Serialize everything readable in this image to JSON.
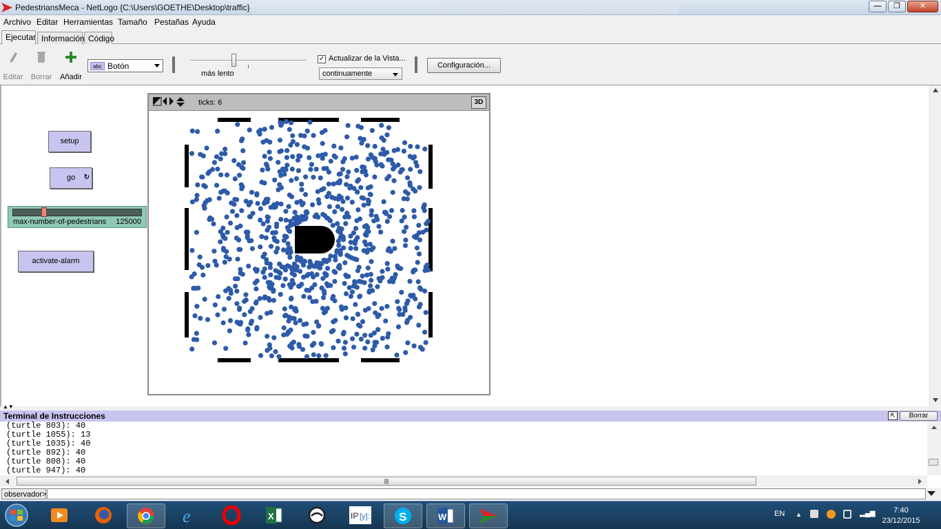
{
  "window": {
    "title": "PedestriansMeca - NetLogo {C:\\Users\\GOETHE\\Desktop\\traffic}",
    "minimize_label": "—",
    "maximize_label": "❐",
    "close_label": "✕"
  },
  "menu": [
    "Archivo",
    "Editar",
    "Herramientas",
    "Tamaño",
    "Pestañas",
    "Ayuda"
  ],
  "tabs": [
    "Ejecutar",
    "Información",
    "Código"
  ],
  "toolbar": {
    "edit_label": "Editar",
    "delete_label": "Borrar",
    "add_label": "Añadir",
    "widget_type": "Botón",
    "widget_type_icon": "abc",
    "speed_label": "más lento",
    "update_view_label": "Actualizar de la Vista...",
    "update_view_checked": true,
    "update_mode": "continuamente",
    "settings_label": "Configuración..."
  },
  "interface": {
    "setup_label": "setup",
    "go_label": "go",
    "go_forever_icon": "forever-arrows-icon",
    "slider": {
      "name": "max-number-of-pedestrians",
      "value": "125000"
    },
    "alarm_label": "activate-alarm"
  },
  "view": {
    "ticks_label": "ticks: 6",
    "three_d_label": "3D",
    "turtle_color": "#2e5ba8"
  },
  "command_center": {
    "title": "Terminal de Instrucciones",
    "clear_label": "Borrar",
    "output": [
      "(turtle 803): 40",
      "(turtle 1055): 13",
      "(turtle 1035): 40",
      "(turtle 892): 40",
      "(turtle 808): 40",
      "(turtle 947): 40"
    ],
    "context": "observador>",
    "input_value": ""
  },
  "taskbar": {
    "apps": [
      "windows-media-player-icon",
      "firefox-icon",
      "chrome-icon",
      "internet-explorer-icon",
      "opera-icon",
      "excel-icon",
      "circle-app-icon",
      "ipython-icon",
      "skype-icon",
      "word-icon",
      "netlogo-icon"
    ],
    "language": "EN",
    "time": "7:40",
    "date": "23/12/2015"
  }
}
